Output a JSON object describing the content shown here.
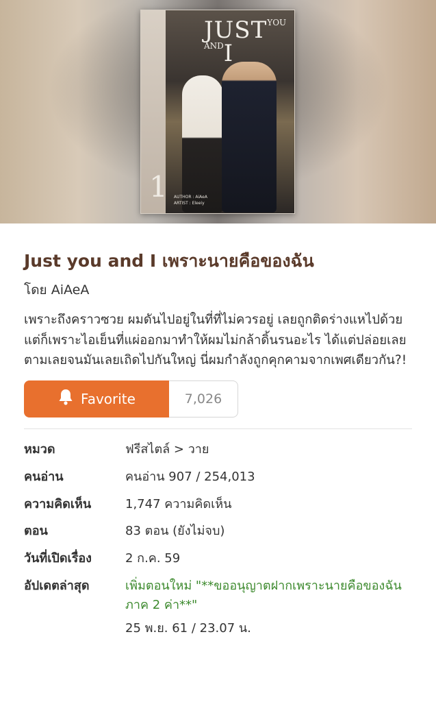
{
  "cover": {
    "title_main": "JUST",
    "title_small": "YOU AND",
    "title_end": "I",
    "volume": "1",
    "credits": [
      "AUTHOR : AiAeA",
      "ARTIST : Eleeiy"
    ]
  },
  "novel": {
    "title": "Just you and I เพราะนายคือของฉัน",
    "author": "โดย AiAeA",
    "synopsis": "เพราะถึงคราวซวย ผมดันไปอยู่ในที่ที่ไม่ควรอยู่ เลยถูกติดร่างแหไปด้วย แต่ก็เพราะไอเย็นที่แผ่ออกมาทำให้ผมไม่กล้าดิ้นรนอะไร ได้แต่ปล่อยเลยตามเลยจนมันเลยเถิดไปกันใหญ่ นี่ผมกำลังถูกคุกคามจากเพศเดียวกัน?!"
  },
  "favorite": {
    "label": "Favorite",
    "count": "7,026",
    "icon": "bell-icon"
  },
  "info": {
    "category_label": "หมวด",
    "category_value": "ฟรีสไตล์ > วาย",
    "readers_label": "คนอ่าน",
    "readers_value": "คนอ่าน 907 / 254,013",
    "comments_label": "ความคิดเห็น",
    "comments_value": "1,747 ความคิดเห็น",
    "episodes_label": "ตอน",
    "episodes_value": "83 ตอน (ยังไม่จบ)",
    "opened_label": "วันที่เปิดเรื่อง",
    "opened_value": "2 ก.ค. 59",
    "updated_label": "อัปเดตล่าสุด",
    "updated_value": "เพิ่มตอนใหม่ \"**ขออนุญาตฝากเพราะนายคือของฉันภาค 2 ค่า**\"",
    "updated_time": "25 พ.ย. 61 / 23.07 น."
  },
  "colors": {
    "accent": "#e8702e",
    "title": "#5a3a2a",
    "update_green": "#3d8a2e"
  }
}
